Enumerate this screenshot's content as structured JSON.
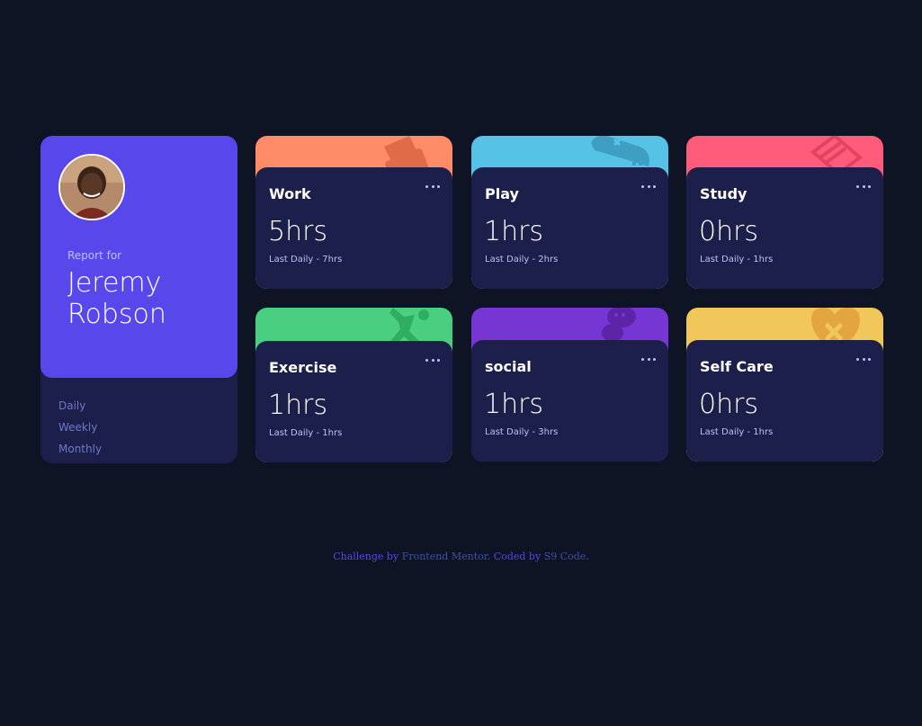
{
  "profile": {
    "report_for": "Report for",
    "name": "Jeremy Robson",
    "timeframes": [
      "Daily",
      "Weekly",
      "Monthly"
    ]
  },
  "cards": [
    {
      "title": "Work",
      "current": "5hrs",
      "previous": "Last Daily - 7hrs",
      "color": "#ff8c66",
      "icon": "briefcase-icon"
    },
    {
      "title": "Play",
      "current": "1hrs",
      "previous": "Last Daily - 2hrs",
      "color": "#56c2e6",
      "icon": "gamepad-icon"
    },
    {
      "title": "Study",
      "current": "0hrs",
      "previous": "Last Daily - 1hrs",
      "color": "#ff5c7c",
      "icon": "books-icon"
    },
    {
      "title": "Exercise",
      "current": "1hrs",
      "previous": "Last Daily - 1hrs",
      "color": "#4acf81",
      "icon": "runner-icon"
    },
    {
      "title": "social",
      "current": "1hrs",
      "previous": "Last Daily - 3hrs",
      "color": "#7536d3",
      "icon": "chat-icon"
    },
    {
      "title": "Self Care",
      "current": "0hrs",
      "previous": "Last Daily - 1hrs",
      "color": "#f1c65b",
      "icon": "heart-icon"
    }
  ],
  "attribution": {
    "challenge_text": "Challenge by",
    "challenge_link": "Frontend Mentor",
    "coded_text": ". Coded by",
    "coded_link": "S9 Code",
    "end": "."
  }
}
